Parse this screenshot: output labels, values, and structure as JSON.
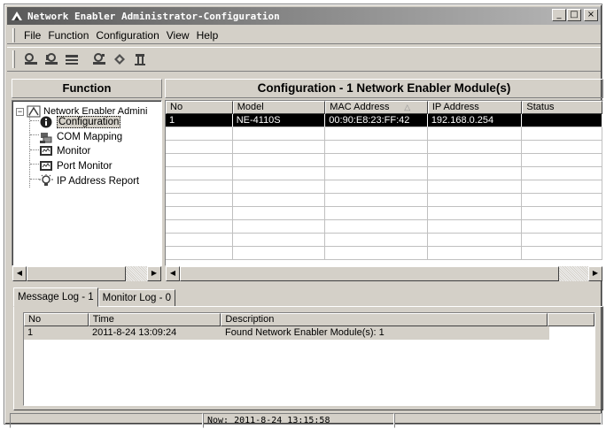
{
  "window": {
    "title": "Network Enabler Administrator-Configuration",
    "min_label": "_",
    "max_label": "□",
    "close_label": "×"
  },
  "menu": [
    "File",
    "Function",
    "Configuration",
    "View",
    "Help"
  ],
  "toolbar": {
    "icons": [
      "search-icon",
      "broadcast-search-icon",
      "network-icon",
      "settings-icon",
      "diskette-icon",
      "person-icon"
    ]
  },
  "function_pane": {
    "header": "Function",
    "root_label": "Network Enabler Admini",
    "expander": "−",
    "items": [
      {
        "label": "Configuration",
        "icon": "info-icon"
      },
      {
        "label": "COM Mapping",
        "icon": "com-mapping-icon"
      },
      {
        "label": "Monitor",
        "icon": "monitor-icon"
      },
      {
        "label": "Port Monitor",
        "icon": "port-monitor-icon"
      },
      {
        "label": "IP Address Report",
        "icon": "lightbulb-icon"
      }
    ]
  },
  "config_pane": {
    "header": "Configuration - 1 Network Enabler Module(s)",
    "columns": [
      "No",
      "Model",
      "MAC Address",
      "IP Address",
      "Status"
    ],
    "sort_indicator": "△",
    "rows": [
      [
        "1",
        "NE-4110S",
        "00:90:E8:23:FF:42",
        "192.168.0.254",
        ""
      ]
    ]
  },
  "tabs": [
    "Message Log - 1",
    "Monitor Log - 0"
  ],
  "message_log": {
    "columns": [
      "No",
      "Time",
      "Description"
    ],
    "rows": [
      [
        "1",
        "2011-8-24 13:09:24",
        "Found Network Enabler Module(s): 1"
      ]
    ]
  },
  "statusbar": {
    "now": "Now: 2011-8-24 13:15:58"
  },
  "colors": {
    "face": "#d4d0c8",
    "selection": "#000000",
    "title_gradient_start": "#5a5a5a"
  }
}
